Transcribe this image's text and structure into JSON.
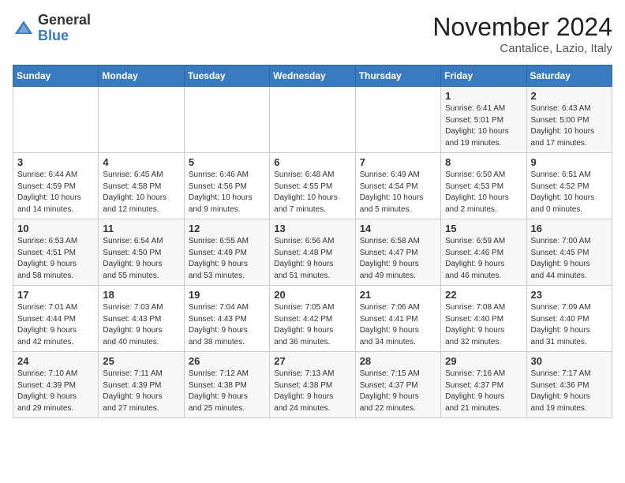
{
  "header": {
    "logo_line1": "General",
    "logo_line2": "Blue",
    "month": "November 2024",
    "location": "Cantalice, Lazio, Italy"
  },
  "weekdays": [
    "Sunday",
    "Monday",
    "Tuesday",
    "Wednesday",
    "Thursday",
    "Friday",
    "Saturday"
  ],
  "weeks": [
    [
      {
        "day": "",
        "info": ""
      },
      {
        "day": "",
        "info": ""
      },
      {
        "day": "",
        "info": ""
      },
      {
        "day": "",
        "info": ""
      },
      {
        "day": "",
        "info": ""
      },
      {
        "day": "1",
        "info": "Sunrise: 6:41 AM\nSunset: 5:01 PM\nDaylight: 10 hours\nand 19 minutes."
      },
      {
        "day": "2",
        "info": "Sunrise: 6:43 AM\nSunset: 5:00 PM\nDaylight: 10 hours\nand 17 minutes."
      }
    ],
    [
      {
        "day": "3",
        "info": "Sunrise: 6:44 AM\nSunset: 4:59 PM\nDaylight: 10 hours\nand 14 minutes."
      },
      {
        "day": "4",
        "info": "Sunrise: 6:45 AM\nSunset: 4:58 PM\nDaylight: 10 hours\nand 12 minutes."
      },
      {
        "day": "5",
        "info": "Sunrise: 6:46 AM\nSunset: 4:56 PM\nDaylight: 10 hours\nand 9 minutes."
      },
      {
        "day": "6",
        "info": "Sunrise: 6:48 AM\nSunset: 4:55 PM\nDaylight: 10 hours\nand 7 minutes."
      },
      {
        "day": "7",
        "info": "Sunrise: 6:49 AM\nSunset: 4:54 PM\nDaylight: 10 hours\nand 5 minutes."
      },
      {
        "day": "8",
        "info": "Sunrise: 6:50 AM\nSunset: 4:53 PM\nDaylight: 10 hours\nand 2 minutes."
      },
      {
        "day": "9",
        "info": "Sunrise: 6:51 AM\nSunset: 4:52 PM\nDaylight: 10 hours\nand 0 minutes."
      }
    ],
    [
      {
        "day": "10",
        "info": "Sunrise: 6:53 AM\nSunset: 4:51 PM\nDaylight: 9 hours\nand 58 minutes."
      },
      {
        "day": "11",
        "info": "Sunrise: 6:54 AM\nSunset: 4:50 PM\nDaylight: 9 hours\nand 55 minutes."
      },
      {
        "day": "12",
        "info": "Sunrise: 6:55 AM\nSunset: 4:49 PM\nDaylight: 9 hours\nand 53 minutes."
      },
      {
        "day": "13",
        "info": "Sunrise: 6:56 AM\nSunset: 4:48 PM\nDaylight: 9 hours\nand 51 minutes."
      },
      {
        "day": "14",
        "info": "Sunrise: 6:58 AM\nSunset: 4:47 PM\nDaylight: 9 hours\nand 49 minutes."
      },
      {
        "day": "15",
        "info": "Sunrise: 6:59 AM\nSunset: 4:46 PM\nDaylight: 9 hours\nand 46 minutes."
      },
      {
        "day": "16",
        "info": "Sunrise: 7:00 AM\nSunset: 4:45 PM\nDaylight: 9 hours\nand 44 minutes."
      }
    ],
    [
      {
        "day": "17",
        "info": "Sunrise: 7:01 AM\nSunset: 4:44 PM\nDaylight: 9 hours\nand 42 minutes."
      },
      {
        "day": "18",
        "info": "Sunrise: 7:03 AM\nSunset: 4:43 PM\nDaylight: 9 hours\nand 40 minutes."
      },
      {
        "day": "19",
        "info": "Sunrise: 7:04 AM\nSunset: 4:43 PM\nDaylight: 9 hours\nand 38 minutes."
      },
      {
        "day": "20",
        "info": "Sunrise: 7:05 AM\nSunset: 4:42 PM\nDaylight: 9 hours\nand 36 minutes."
      },
      {
        "day": "21",
        "info": "Sunrise: 7:06 AM\nSunset: 4:41 PM\nDaylight: 9 hours\nand 34 minutes."
      },
      {
        "day": "22",
        "info": "Sunrise: 7:08 AM\nSunset: 4:40 PM\nDaylight: 9 hours\nand 32 minutes."
      },
      {
        "day": "23",
        "info": "Sunrise: 7:09 AM\nSunset: 4:40 PM\nDaylight: 9 hours\nand 31 minutes."
      }
    ],
    [
      {
        "day": "24",
        "info": "Sunrise: 7:10 AM\nSunset: 4:39 PM\nDaylight: 9 hours\nand 29 minutes."
      },
      {
        "day": "25",
        "info": "Sunrise: 7:11 AM\nSunset: 4:39 PM\nDaylight: 9 hours\nand 27 minutes."
      },
      {
        "day": "26",
        "info": "Sunrise: 7:12 AM\nSunset: 4:38 PM\nDaylight: 9 hours\nand 25 minutes."
      },
      {
        "day": "27",
        "info": "Sunrise: 7:13 AM\nSunset: 4:38 PM\nDaylight: 9 hours\nand 24 minutes."
      },
      {
        "day": "28",
        "info": "Sunrise: 7:15 AM\nSunset: 4:37 PM\nDaylight: 9 hours\nand 22 minutes."
      },
      {
        "day": "29",
        "info": "Sunrise: 7:16 AM\nSunset: 4:37 PM\nDaylight: 9 hours\nand 21 minutes."
      },
      {
        "day": "30",
        "info": "Sunrise: 7:17 AM\nSunset: 4:36 PM\nDaylight: 9 hours\nand 19 minutes."
      }
    ]
  ]
}
